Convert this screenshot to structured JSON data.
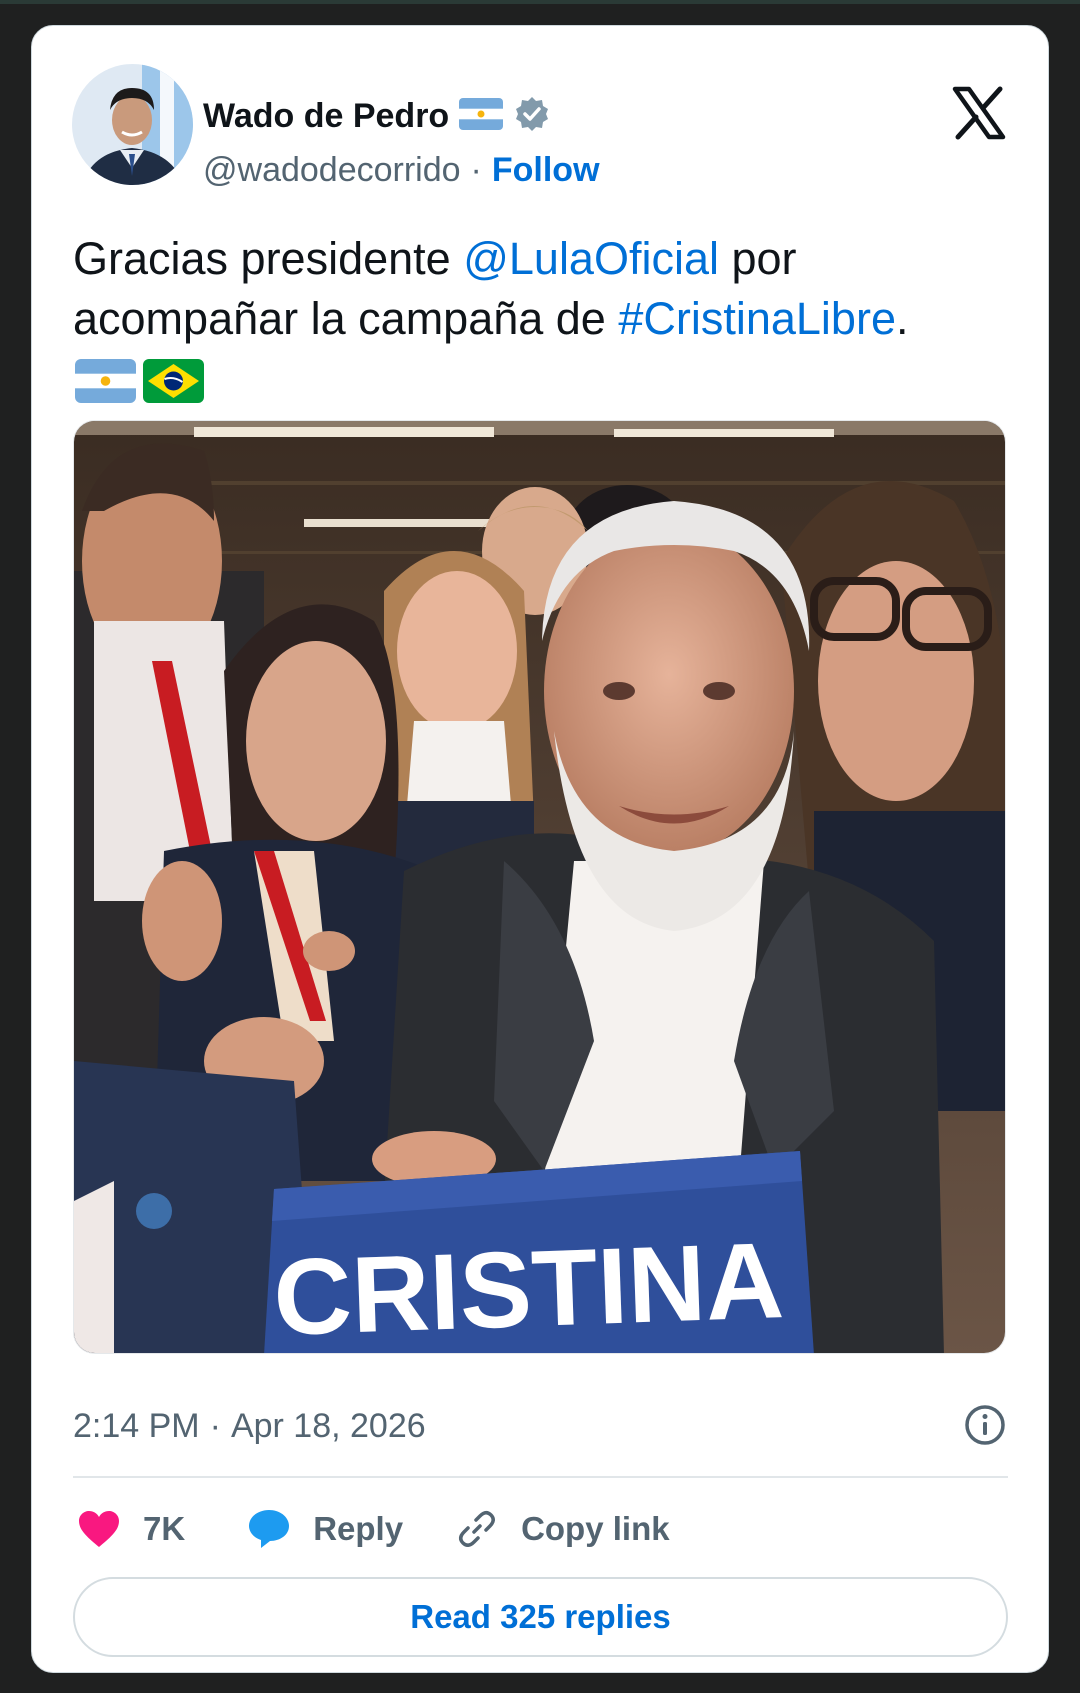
{
  "author": {
    "display_name": "Wado de Pedro",
    "handle": "@wadodecorrido",
    "separator": "·",
    "follow_label": "Follow",
    "verified": true,
    "name_flag": "argentina-flag"
  },
  "platform": {
    "logo": "x-logo"
  },
  "tweet": {
    "text_part1": "Gracias presidente ",
    "mention": "@LulaOficial",
    "text_part2": " por acompañar la campaña de ",
    "hashtag": "#CristinaLibre",
    "text_part3": ".",
    "flags": [
      "argentina-flag",
      "brazil-flag"
    ]
  },
  "photo": {
    "sign_text": "CRISTINA"
  },
  "meta": {
    "time": "2:14 PM",
    "separator": "·",
    "date": "Apr 18, 2026"
  },
  "actions": {
    "like_count": "7K",
    "reply_label": "Reply",
    "copy_label": "Copy link"
  },
  "read_replies_label": "Read 325 replies",
  "colors": {
    "link": "#006fd6",
    "like": "#f91880",
    "reply": "#1d9bf0",
    "text": "#0f1419",
    "muted": "#536471"
  }
}
